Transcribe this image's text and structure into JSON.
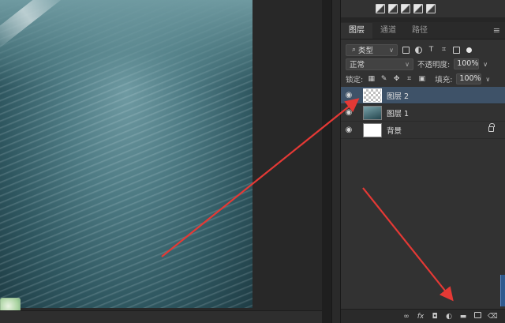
{
  "panel": {
    "tabs": [
      {
        "label": "图层",
        "active": true
      },
      {
        "label": "通道",
        "active": false
      },
      {
        "label": "路径",
        "active": false
      }
    ],
    "filter": {
      "label": "类型"
    },
    "blend": {
      "mode": "正常",
      "opacity_label": "不透明度:",
      "opacity_value": "100%"
    },
    "lock": {
      "label": "锁定:",
      "fill_label": "填充:",
      "fill_value": "100%"
    },
    "layers": [
      {
        "name": "图层 2",
        "thumb": "transparent",
        "selected": true
      },
      {
        "name": "图层 1",
        "thumb": "photo",
        "selected": false
      },
      {
        "name": "背景",
        "thumb": "white",
        "selected": false,
        "locked": true
      }
    ],
    "bottom_icons": [
      "link-icon",
      "fx-icon",
      "mask-icon",
      "adjustment-icon",
      "folder-icon",
      "new-layer-icon",
      "trash-icon"
    ]
  },
  "colors": {
    "selected_layer": "#3e5268",
    "arrow": "#e53935",
    "panel_bg": "#323232"
  }
}
